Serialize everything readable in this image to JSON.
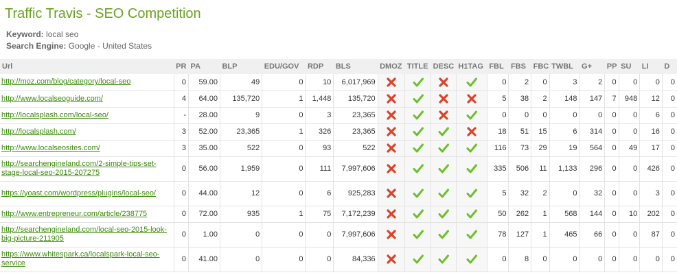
{
  "page": {
    "title": "Traffic Travis - SEO Competition",
    "keyword_label": "Keyword:",
    "keyword_value": "local seo",
    "engine_label": "Search Engine:",
    "engine_value": "Google - United States"
  },
  "columns": [
    "Url",
    "PR",
    "PA",
    "BLP",
    "EDU/GOV",
    "RDP",
    "BLS",
    "DMOZ",
    "TITLE",
    "DESC",
    "H1TAG",
    "FBL",
    "FBS",
    "FBC",
    "TWBL",
    "G+",
    "PP",
    "SU",
    "LI",
    "D"
  ],
  "colors": {
    "accent": "#6aa121",
    "link": "#3b8a0a",
    "check": "#6cbf2c",
    "cross": "#d9432b"
  },
  "rows": [
    {
      "url": "http://moz.com/blog/category/local-seo",
      "pr": "0",
      "pa": "59.00",
      "blp": "49",
      "edu": "0",
      "rdp": "10",
      "bls": "6,017,969",
      "dmoz": "no",
      "title": "yes",
      "desc": "no",
      "h1": "yes",
      "fbl": "0",
      "fbs": "2",
      "fbc": "0",
      "twbl": "3",
      "gplus": "2",
      "pp": "0",
      "su": "0",
      "li": "0",
      "d": "0"
    },
    {
      "url": "http://www.localseoguide.com/",
      "pr": "4",
      "pa": "64.00",
      "blp": "135,720",
      "edu": "1",
      "rdp": "1,448",
      "bls": "135,720",
      "dmoz": "no",
      "title": "yes",
      "desc": "no",
      "h1": "no",
      "fbl": "5",
      "fbs": "38",
      "fbc": "2",
      "twbl": "148",
      "gplus": "147",
      "pp": "7",
      "su": "948",
      "li": "12",
      "d": "0"
    },
    {
      "url": "http://localsplash.com/local-seo/",
      "pr": "-",
      "pa": "28.00",
      "blp": "9",
      "edu": "0",
      "rdp": "3",
      "bls": "23,365",
      "dmoz": "no",
      "title": "yes",
      "desc": "no",
      "h1": "yes",
      "fbl": "0",
      "fbs": "0",
      "fbc": "0",
      "twbl": "0",
      "gplus": "0",
      "pp": "0",
      "su": "0",
      "li": "6",
      "d": "0"
    },
    {
      "url": "http://localsplash.com/",
      "pr": "3",
      "pa": "52.00",
      "blp": "23,365",
      "edu": "1",
      "rdp": "326",
      "bls": "23,365",
      "dmoz": "no",
      "title": "yes",
      "desc": "yes",
      "h1": "no",
      "fbl": "18",
      "fbs": "51",
      "fbc": "15",
      "twbl": "6",
      "gplus": "314",
      "pp": "0",
      "su": "0",
      "li": "16",
      "d": "0"
    },
    {
      "url": "http://www.localseosites.com/",
      "pr": "3",
      "pa": "35.00",
      "blp": "522",
      "edu": "0",
      "rdp": "93",
      "bls": "522",
      "dmoz": "no",
      "title": "yes",
      "desc": "yes",
      "h1": "yes",
      "fbl": "116",
      "fbs": "73",
      "fbc": "29",
      "twbl": "19",
      "gplus": "564",
      "pp": "0",
      "su": "49",
      "li": "17",
      "d": "0"
    },
    {
      "url": "http://searchengineland.com/2-simple-tips-set-stage-local-seo-2015-207275",
      "pr": "0",
      "pa": "56.00",
      "blp": "1,959",
      "edu": "0",
      "rdp": "111",
      "bls": "7,997,606",
      "dmoz": "no",
      "title": "yes",
      "desc": "yes",
      "h1": "yes",
      "fbl": "335",
      "fbs": "506",
      "fbc": "11",
      "twbl": "1,133",
      "gplus": "296",
      "pp": "0",
      "su": "0",
      "li": "426",
      "d": "0"
    },
    {
      "url": "https://yoast.com/wordpress/plugins/local-seo/",
      "pr": "0",
      "pa": "44.00",
      "blp": "12",
      "edu": "0",
      "rdp": "6",
      "bls": "925,283",
      "dmoz": "no",
      "title": "yes",
      "desc": "yes",
      "h1": "yes",
      "fbl": "5",
      "fbs": "32",
      "fbc": "2",
      "twbl": "0",
      "gplus": "32",
      "pp": "0",
      "su": "0",
      "li": "3",
      "d": "0"
    },
    {
      "url": "http://www.entrepreneur.com/article/238775",
      "pr": "0",
      "pa": "72.00",
      "blp": "935",
      "edu": "1",
      "rdp": "75",
      "bls": "7,172,239",
      "dmoz": "no",
      "title": "yes",
      "desc": "yes",
      "h1": "yes",
      "fbl": "50",
      "fbs": "262",
      "fbc": "1",
      "twbl": "568",
      "gplus": "144",
      "pp": "0",
      "su": "10",
      "li": "202",
      "d": "0"
    },
    {
      "url": "http://searchengineland.com/local-seo-2015-look-big-picture-211905",
      "pr": "0",
      "pa": "1.00",
      "blp": "0",
      "edu": "0",
      "rdp": "0",
      "bls": "7,997,606",
      "dmoz": "no",
      "title": "yes",
      "desc": "yes",
      "h1": "yes",
      "fbl": "78",
      "fbs": "127",
      "fbc": "1",
      "twbl": "465",
      "gplus": "66",
      "pp": "0",
      "su": "0",
      "li": "87",
      "d": "0"
    },
    {
      "url": "https://www.whitespark.ca/localspark-local-seo-service",
      "pr": "0",
      "pa": "41.00",
      "blp": "0",
      "edu": "0",
      "rdp": "0",
      "bls": "84,336",
      "dmoz": "no",
      "title": "yes",
      "desc": "yes",
      "h1": "yes",
      "fbl": "0",
      "fbs": "8",
      "fbc": "0",
      "twbl": "0",
      "gplus": "0",
      "pp": "0",
      "su": "0",
      "li": "0",
      "d": "0"
    }
  ]
}
